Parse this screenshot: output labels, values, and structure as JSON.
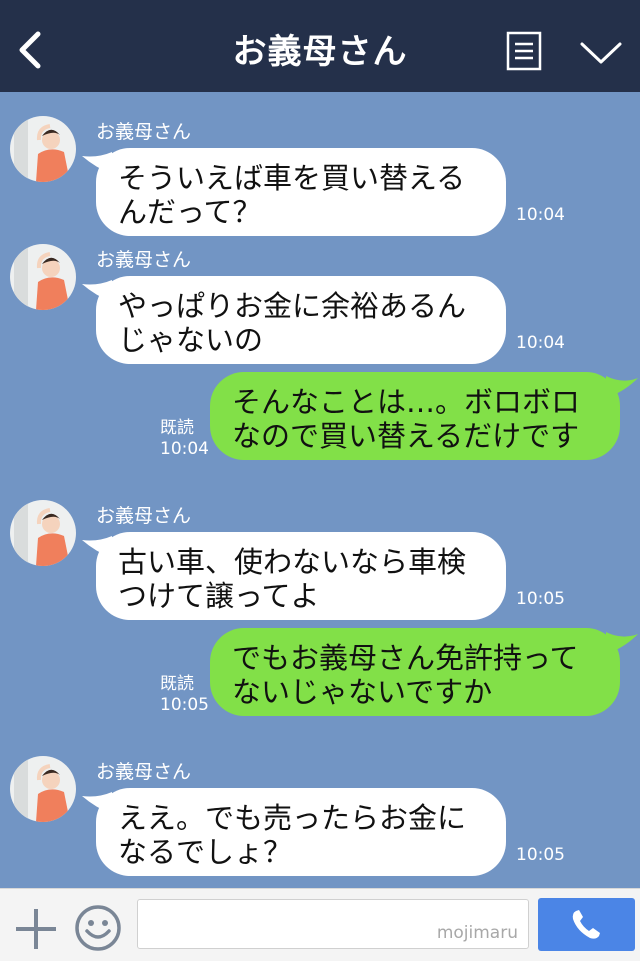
{
  "header": {
    "title": "お義母さん"
  },
  "messages": [
    {
      "sender": "お義母さん",
      "lines": [
        "そういえば車を買い替える",
        "んだって？"
      ],
      "time": "10:04"
    },
    {
      "sender": "お義母さん",
      "lines": [
        "やっぱりお金に余裕あるん",
        "じゃないの"
      ],
      "time": "10:04"
    },
    {
      "read": "既読",
      "lines": [
        "そんなことは…。ボロボロ",
        "なので買い替えるだけです"
      ],
      "time": "10:04"
    },
    {
      "sender": "お義母さん",
      "lines": [
        "古い車、使わないなら車検",
        "つけて譲ってよ"
      ],
      "time": "10:05"
    },
    {
      "read": "既読",
      "lines": [
        "でもお義母さん免許持って",
        "ないじゃないですか"
      ],
      "time": "10:05"
    },
    {
      "sender": "お義母さん",
      "lines": [
        "ええ。でも売ったらお金に",
        "なるでしょ？"
      ],
      "time": "10:05"
    }
  ],
  "input": {
    "value": "",
    "watermark": "mojimaru"
  },
  "colors": {
    "header": "#24304a",
    "background": "#7295c4",
    "outgoing": "#82e048",
    "incoming": "#ffffff",
    "call_button": "#4b85e6"
  },
  "icons": {
    "back": "chevron-left-icon",
    "menu": "document-menu-icon",
    "collapse": "chevron-down-icon",
    "add": "plus-icon",
    "sticker": "smiley-icon",
    "call": "phone-icon"
  }
}
